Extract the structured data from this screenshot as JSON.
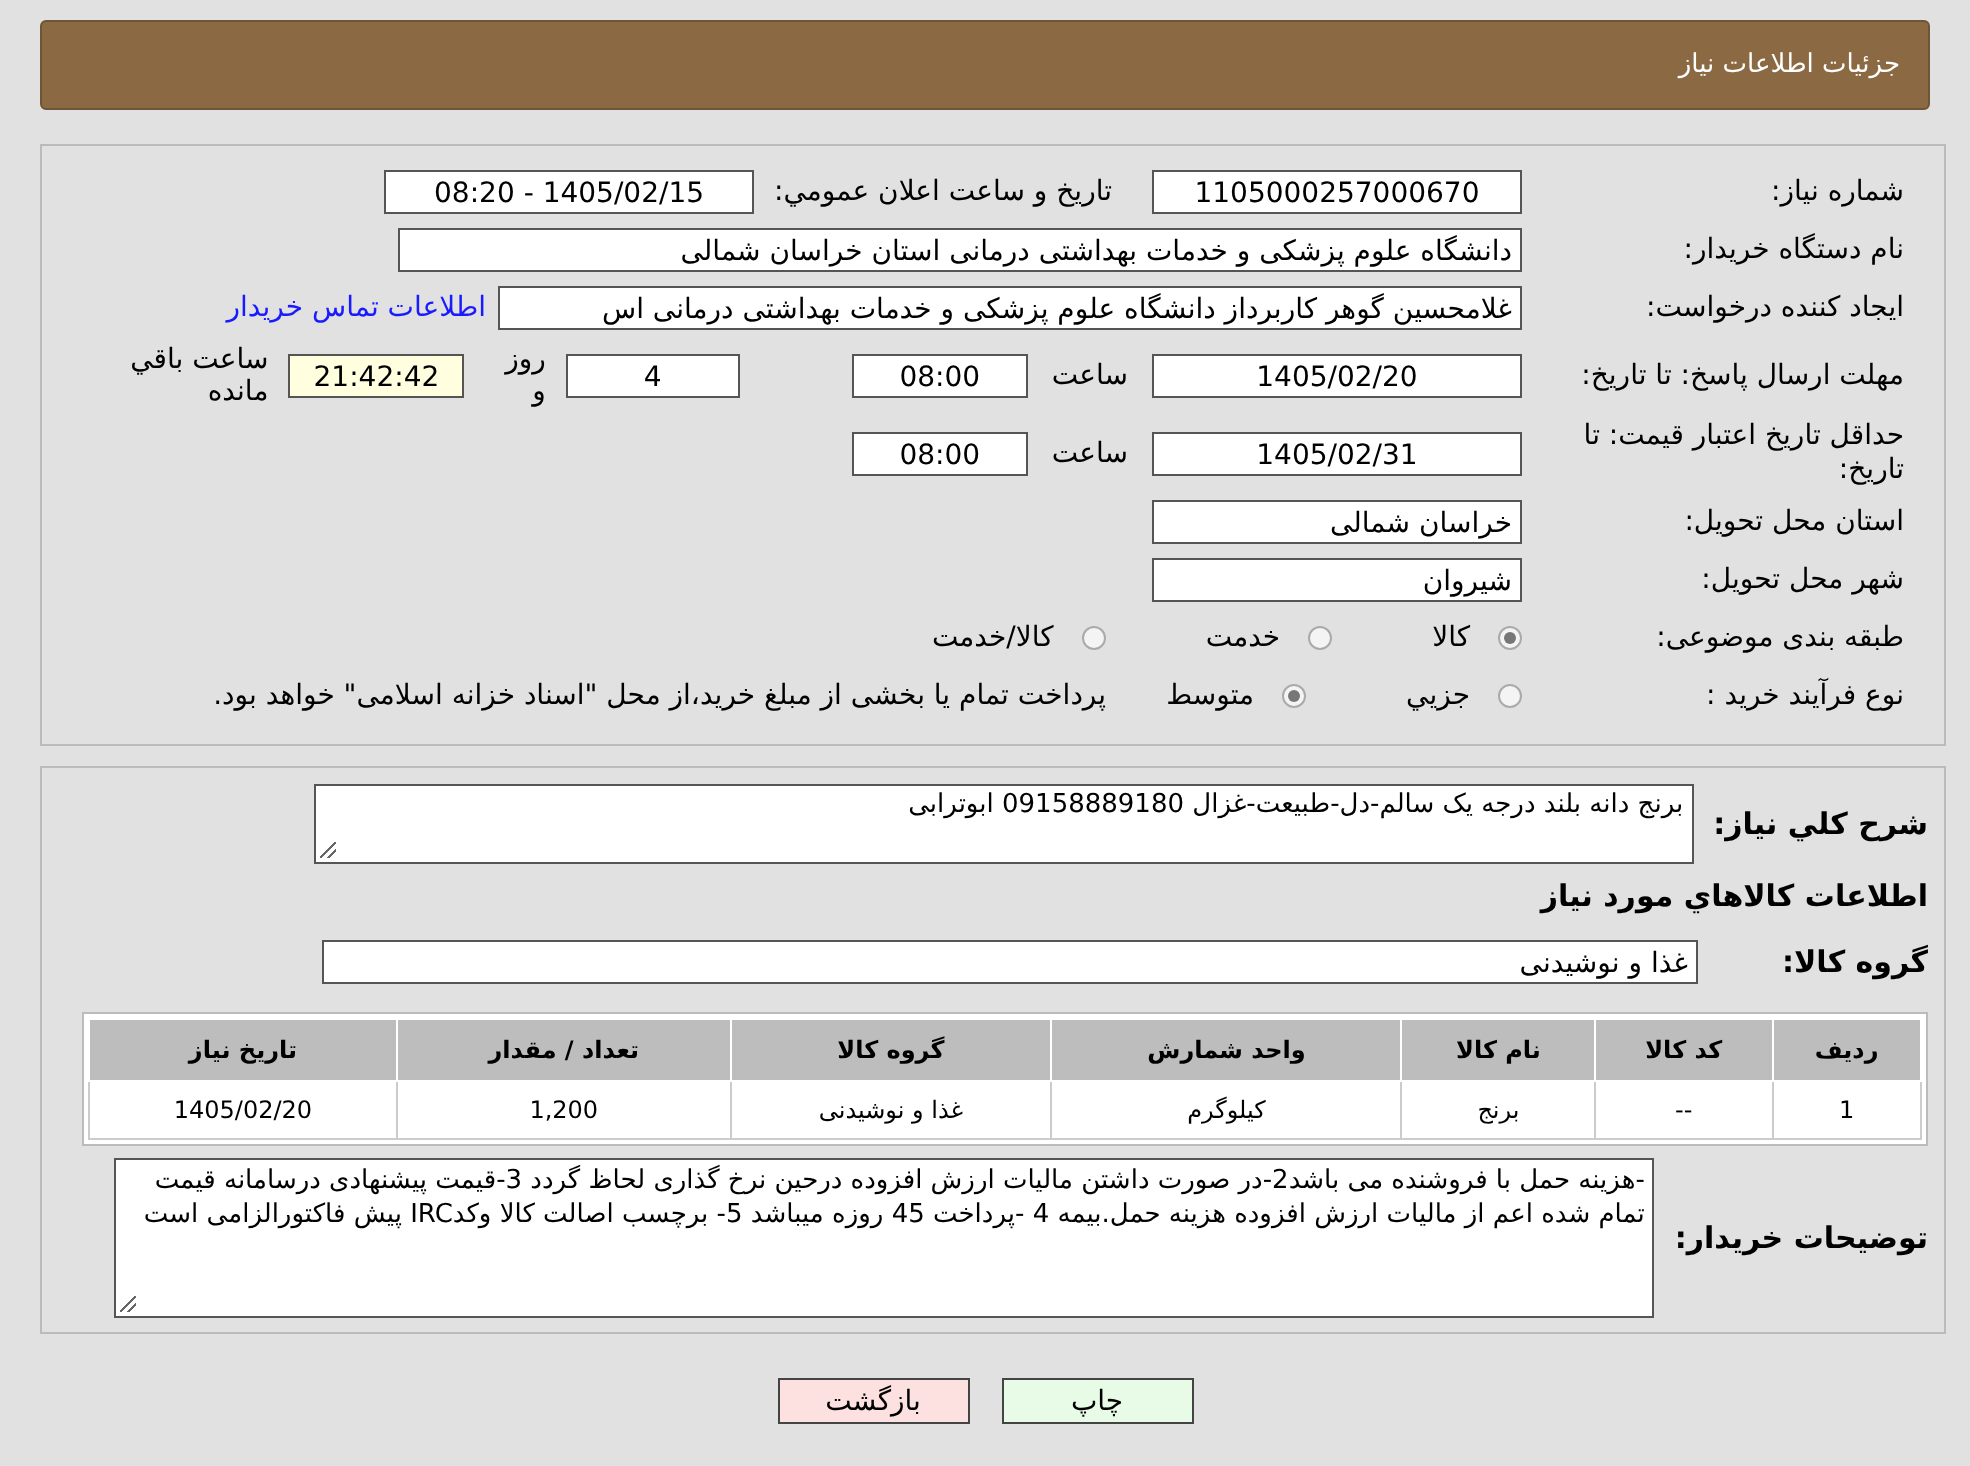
{
  "header": {
    "title": "جزئیات اطلاعات نیاز"
  },
  "need_number": {
    "label": "شماره نیاز:",
    "value": "1105000257000670"
  },
  "announce": {
    "label": "تاريخ و ساعت اعلان عمومي:",
    "value": "1405/02/15 - 08:20"
  },
  "buyer_org": {
    "label": "نام دستگاه خریدار:",
    "value": "دانشگاه علوم پزشکی و خدمات بهداشتی درمانی استان خراسان شمالی"
  },
  "creator": {
    "label": "ایجاد کننده درخواست:",
    "value": "غلامحسین گوهر کاربرداز  دانشگاه علوم پزشکی و خدمات بهداشتی درمانی اس",
    "link": "اطلاعات تماس خریدار"
  },
  "deadline": {
    "label": "مهلت ارسال پاسخ: تا تاریخ:",
    "date": "1405/02/20",
    "time_label": "ساعت",
    "time": "08:00",
    "days": "4",
    "days_label": "روز و",
    "remaining": "21:42:42",
    "remaining_label": "ساعت باقي مانده"
  },
  "validity": {
    "label": "حداقل تاریخ اعتبار قیمت: تا تاریخ:",
    "date": "1405/02/31",
    "time_label": "ساعت",
    "time": "08:00"
  },
  "province": {
    "label": "استان محل تحویل:",
    "value": "خراسان شمالی"
  },
  "city": {
    "label": "شهر محل تحویل:",
    "value": "شیروان"
  },
  "category": {
    "label": "طبقه بندی موضوعی:",
    "options": [
      {
        "label": "کالا",
        "selected": true
      },
      {
        "label": "خدمت",
        "selected": false
      },
      {
        "label": "کالا/خدمت",
        "selected": false
      }
    ]
  },
  "process": {
    "label": "نوع فرآیند خرید :",
    "options": [
      {
        "label": "جزيي",
        "selected": false
      },
      {
        "label": "متوسط",
        "selected": true
      }
    ],
    "note": "پرداخت تمام یا بخشی از مبلغ خرید،از محل \"اسناد خزانه اسلامی\" خواهد بود."
  },
  "description": {
    "label": "شرح کلي نیاز:",
    "value": "برنج دانه بلند درجه یک سالم-دل-طبیعت-غزال 09158889180 ابوترابی"
  },
  "items_title": "اطلاعات کالاهاي مورد نیاز",
  "goods_group": {
    "label": "گروه کالا:",
    "value": "غذا و نوشیدنی"
  },
  "table": {
    "columns": [
      "ردیف",
      "کد کالا",
      "نام کالا",
      "واحد شمارش",
      "گروه کالا",
      "تعداد / مقدار",
      "تاریخ نیاز"
    ],
    "rows": [
      [
        "1",
        "--",
        "برنج",
        "کیلوگرم",
        "غذا و نوشیدنی",
        "1,200",
        "1405/02/20"
      ]
    ]
  },
  "notes": {
    "label": "توضیحات خریدار:",
    "value": "-هزینه حمل با فروشنده می باشد2-در صورت داشتن مالیات ارزش افزوده درحین نرخ گذاری لحاظ گردد 3-قیمت پیشنهادی درسامانه  قیمت تمام شده اعم از مالیات ارزش افزوده هزینه حمل.بیمه  4 -پرداخت 45 روزه میباشد 5- برچسب اصالت کالا وکدIRC پیش فاکتورالزامی است"
  },
  "buttons": [
    {
      "label": "چاپ",
      "kind": "print"
    },
    {
      "label": "بازگشت",
      "kind": "back"
    }
  ]
}
